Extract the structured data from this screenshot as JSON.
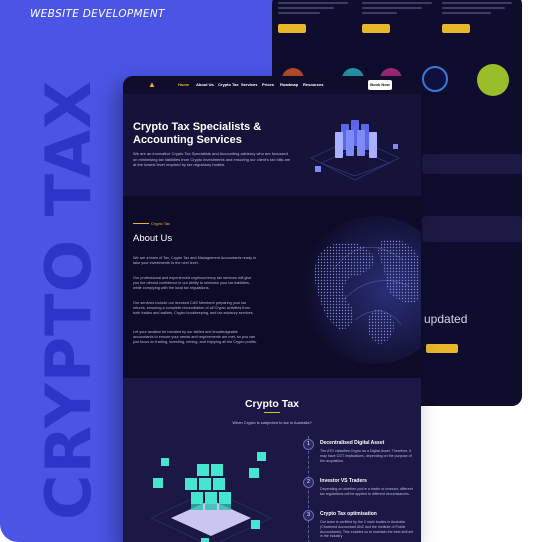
{
  "tag": "WEBSITE DEVELOPMENT",
  "big_title": "CRYPTO TAX",
  "colors": {
    "panel": "#4a55e6",
    "title": "#2b36c9",
    "site_bg": "#16133a",
    "accent": "#e9b62a"
  },
  "back_shot": {
    "updated_text": "updated"
  },
  "front_shot": {
    "nav": {
      "logo_icon": "flame-icon",
      "items": [
        "Home",
        "About Us",
        "Crypto Tax",
        "Services",
        "Prices",
        "Roadmap",
        "Resources"
      ],
      "active_index": 0,
      "button": "Book Now"
    },
    "hero": {
      "title": "Crypto Tax Specialists & Accounting Services",
      "text": "We are an innovative Crypto Tax Specialists and Accounting advisory who are focussed on minimising tax liabilities from Crypto investments and ensuring our client's tax bills are at the lowest level required by tax regulatory bodies."
    },
    "about": {
      "pre": "Crypto Tax",
      "title": "About Us",
      "paragraphs": [
        "We are a team of Tax, Crypto Tax and Management Accountants ready to take your investments to the next level.",
        "Our professional and experienced cryptocurrency tax services will give you the utmost confidence in our ability to minimise your tax liabilities, while complying with the local tax regulations.",
        "Our services include our licensed CAS Members preparing your tax returns, ensuring a complete reconciliation of all Crypto activities from both trades and wallets, Crypto bookkeeping, and tax advisory services.",
        "Let your taxation be handled by our skilled and knowledgeable accountants to ensure your needs and requirements are met, so you can just focus on trading, investing, mining, and enjoying all the Crypto profits."
      ]
    },
    "crypto": {
      "title": "Crypto Tax",
      "subtitle": "When Crypto is subjected to tax in Australia?",
      "features": [
        {
          "num": "1",
          "title": "Decentralised Digital Asset",
          "text": "The ATO classifies Crypto as a Digital Asset. Therefore, it may have CGT implications, depending on the purpose of the acquisition."
        },
        {
          "num": "2",
          "title": "Investor VS Traders",
          "text": "Depending on whether you're a trader or investor, different tax regulations will be applied to different circumstances."
        },
        {
          "num": "3",
          "title": "Crypto Tax optimisation",
          "text": "Our team is certified by the 2 main bodies in Australia (Chartered Accountant ANZ and the Institute of Public Accountants). This enables us to maintain the best skill set in the industry"
        }
      ]
    }
  }
}
